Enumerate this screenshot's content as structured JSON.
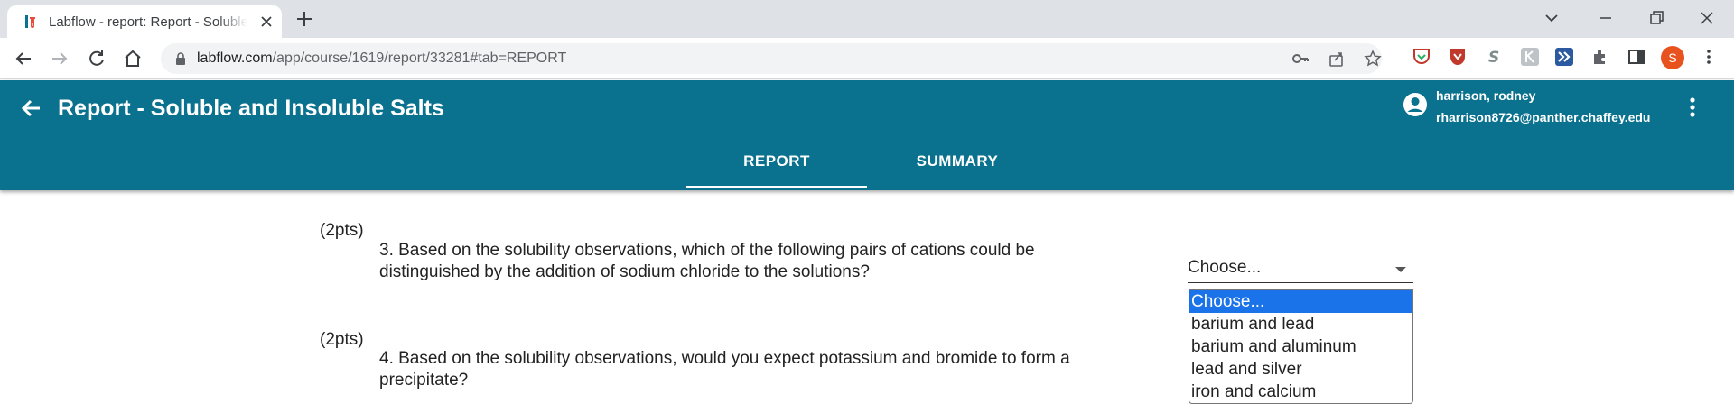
{
  "browser": {
    "tab_title": "Labflow - report: Report - Soluble and Insoluble Salts",
    "url_host": "labflow.com",
    "url_path": "/app/course/1619/report/33281#tab=REPORT",
    "profile_initial": "S",
    "profile_color": "#e8521e"
  },
  "header": {
    "title": "Report - Soluble and Insoluble Salts",
    "user_name": "harrison, rodney",
    "user_email": "rharrison8726@panther.chaffey.edu",
    "color": "#0a718e"
  },
  "tabs": [
    {
      "label": "REPORT",
      "active": true
    },
    {
      "label": "SUMMARY",
      "active": false
    }
  ],
  "questions": [
    {
      "points": "(2pts)",
      "text": "3. Based on the solubility observations, which of the following pairs of cations could be distinguished by the addition of sodium chloride to the solutions?"
    },
    {
      "points": "(2pts)",
      "text": "4. Based on the solubility observations, would you expect potassium and bromide to form a precipitate?"
    }
  ],
  "select": {
    "value": "Choose...",
    "options": [
      "Choose...",
      "barium and lead",
      "barium and aluminum",
      "lead and silver",
      "iron and calcium"
    ],
    "selected_index": 0
  }
}
